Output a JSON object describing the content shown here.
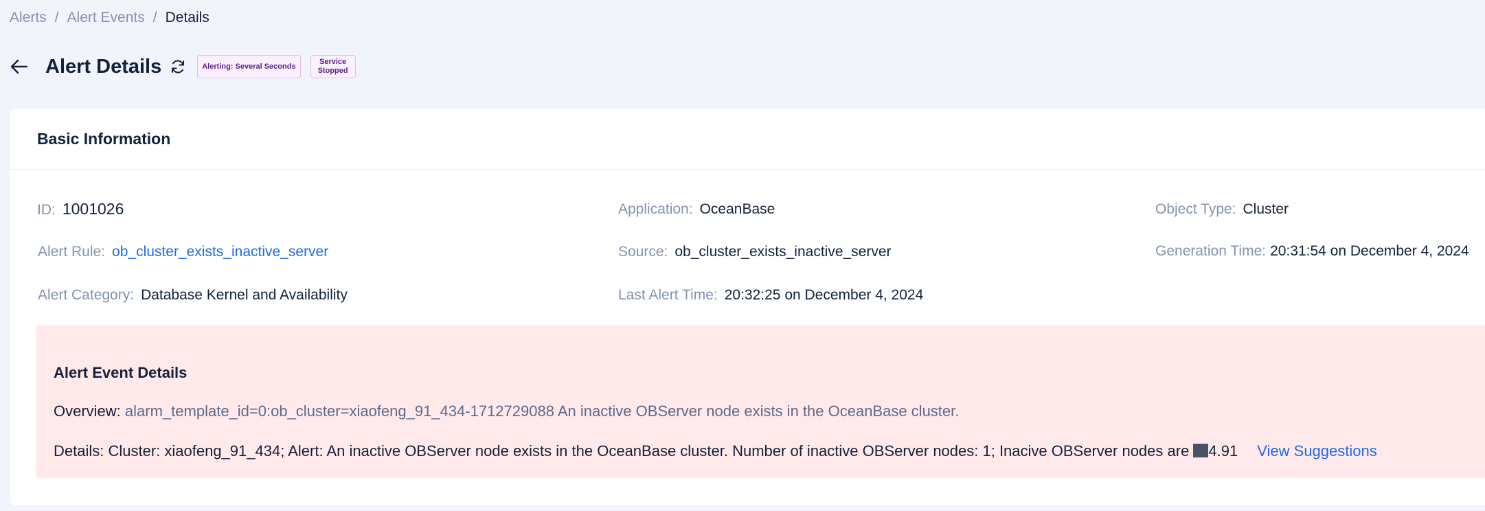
{
  "breadcrumb": {
    "items": [
      "Alerts",
      "Alert Events"
    ],
    "current": "Details",
    "separator": "/"
  },
  "header": {
    "title": "Alert Details",
    "tags": {
      "alerting": "Alerting: Several Seconds",
      "service_line1": "Service",
      "service_line2": "Stopped"
    }
  },
  "card": {
    "title": "Basic Information"
  },
  "fields": {
    "id_label": "ID:",
    "id_value": "1001026",
    "application_label": "Application:",
    "application_value": "OceanBase",
    "object_type_label": "Object Type:",
    "object_type_value": "Cluster",
    "alert_rule_label": "Alert Rule:",
    "alert_rule_value": "ob_cluster_exists_inactive_server",
    "source_label": "Source:",
    "source_value": "ob_cluster_exists_inactive_server",
    "generation_time_label": "Generation Time:",
    "generation_time_value": "20:31:54 on December 4, 2024",
    "alert_category_label": "Alert Category:",
    "alert_category_value": "Database Kernel and Availability",
    "last_alert_time_label": "Last Alert Time:",
    "last_alert_time_value": "20:32:25 on December 4, 2024"
  },
  "event": {
    "title": "Alert Event Details",
    "overview_label": "Overview:",
    "overview_value": "alarm_template_id=0:ob_cluster=xiaofeng_91_434-1712729088 An inactive OBServer node exists in the OceanBase cluster.",
    "details_text": "Details: Cluster: xiaofeng_91_434; Alert: An inactive OBServer node exists in the OceanBase cluster. Number of inactive OBServer nodes: 1; Inacive OBServer nodes are ",
    "details_suffix": "4.91",
    "view_suggestions": "View Suggestions"
  },
  "colors": {
    "background": "#f2f4fc",
    "link": "#1e6ce6",
    "event_bg": "#ffe9ea",
    "tag_bg": "#fbf1fc",
    "tag_text": "#5c1f8a"
  }
}
